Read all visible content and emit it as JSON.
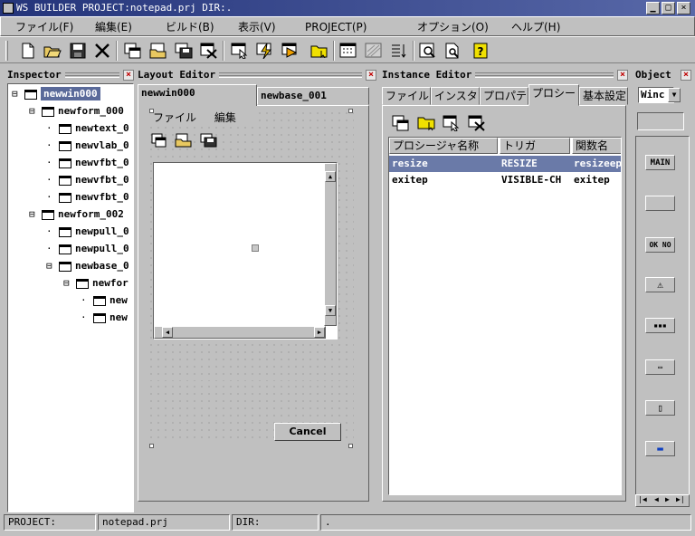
{
  "window": {
    "title": "WS BUILDER PROJECT:notepad.prj DIR:."
  },
  "menu": [
    {
      "label": "ファイル(F)"
    },
    {
      "label": "編集(E)"
    },
    {
      "label": "ビルド(B)"
    },
    {
      "label": "表示(V)"
    },
    {
      "label": "PROJECT(P)"
    },
    {
      "label": "オプション(O)"
    },
    {
      "label": "ヘルプ(H)"
    }
  ],
  "toolbar": [
    {
      "name": "new-file-icon"
    },
    {
      "name": "open-folder-icon"
    },
    {
      "name": "save-icon"
    },
    {
      "name": "cut-icon"
    },
    {
      "name": "new-window-icon"
    },
    {
      "name": "open-window-icon"
    },
    {
      "name": "save-window-icon"
    },
    {
      "name": "delete-window-icon"
    },
    {
      "name": "select-icon"
    },
    {
      "name": "build-icon"
    },
    {
      "name": "run-icon"
    },
    {
      "name": "folder-icon"
    },
    {
      "name": "grid-icon"
    },
    {
      "name": "stripes-icon"
    },
    {
      "name": "sort-icon"
    },
    {
      "name": "preview-icon"
    },
    {
      "name": "find-icon"
    },
    {
      "name": "help-icon"
    }
  ],
  "inspector": {
    "title": "Inspector",
    "nodes": [
      {
        "label": "newwin000",
        "depth": 0,
        "toggle": "⊟",
        "selected": true
      },
      {
        "label": "newform_000",
        "depth": 1,
        "toggle": "⊟"
      },
      {
        "label": "newtext_0",
        "depth": 2
      },
      {
        "label": "newvlab_0",
        "depth": 2
      },
      {
        "label": "newvfbt_0",
        "depth": 2
      },
      {
        "label": "newvfbt_0",
        "depth": 2
      },
      {
        "label": "newvfbt_0",
        "depth": 2
      },
      {
        "label": "newform_002",
        "depth": 1,
        "toggle": "⊟"
      },
      {
        "label": "newpull_0",
        "depth": 2
      },
      {
        "label": "newpull_0",
        "depth": 2
      },
      {
        "label": "newbase_0",
        "depth": 2,
        "toggle": "⊟"
      },
      {
        "label": "newfor",
        "depth": 3,
        "toggle": "⊟"
      },
      {
        "label": "new",
        "depth": 4
      },
      {
        "label": "new",
        "depth": 4
      }
    ]
  },
  "layout": {
    "title": "Layout Editor",
    "tabs": [
      {
        "label": "newwin000"
      },
      {
        "label": "newbase_001"
      }
    ],
    "canvas_menu": [
      {
        "label": "ファイル"
      },
      {
        "label": "編集"
      }
    ],
    "cancel_label": "Cancel"
  },
  "instance": {
    "title": "Instance Editor",
    "tabs": [
      {
        "label": "ファイル"
      },
      {
        "label": "インスタ"
      },
      {
        "label": "プロパテ"
      },
      {
        "label": "プロシー"
      },
      {
        "label": "基本設定"
      }
    ],
    "columns": [
      "プロシージャ名称",
      "トリガ",
      "関数名"
    ],
    "rows": [
      [
        "resize",
        "RESIZE",
        "resizeep"
      ],
      [
        "exitep",
        "VISIBLE-CH",
        "exitep"
      ]
    ]
  },
  "object": {
    "title": "Object",
    "selector": "Winc",
    "palette": [
      "MAIN",
      "",
      "OK NO",
      "⚠",
      "▪▪▪",
      "▭",
      "▯",
      "▬"
    ]
  },
  "status": {
    "project_label": "PROJECT:",
    "project": "notepad.prj",
    "dir_label": "DIR:",
    "dir": "."
  }
}
